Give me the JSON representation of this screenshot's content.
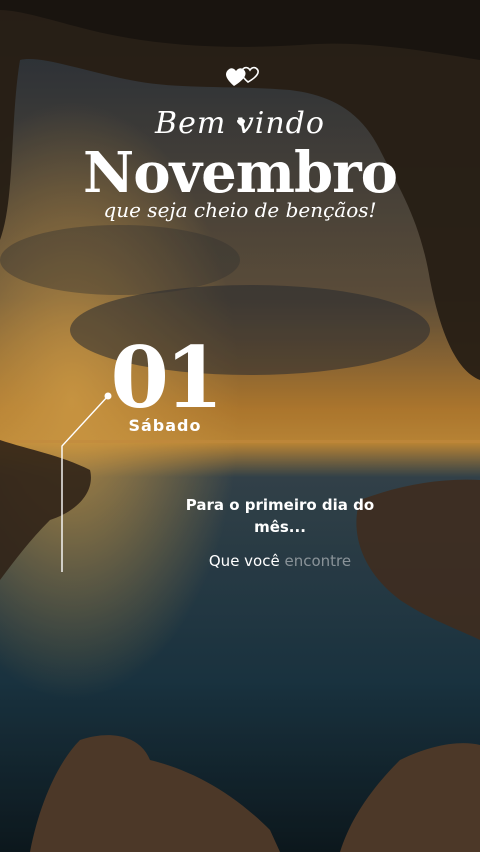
{
  "greeting": {
    "welcome": "Bem vindo",
    "month": "Novembro",
    "tagline": "que seja cheio de bençãos!"
  },
  "date": {
    "day": "01",
    "weekday": "Sábado"
  },
  "message": {
    "line1": "Para o primeiro dia do mês...",
    "line2_visible": "Que você ",
    "line2_faded": "encontre"
  },
  "icons": [
    "double-heart-icon",
    "small-heart-icon"
  ],
  "colors": {
    "text": "#ffffff",
    "sky": "#c98a35",
    "sea": "#1e3b4a",
    "rock": "#3a2a1c"
  }
}
